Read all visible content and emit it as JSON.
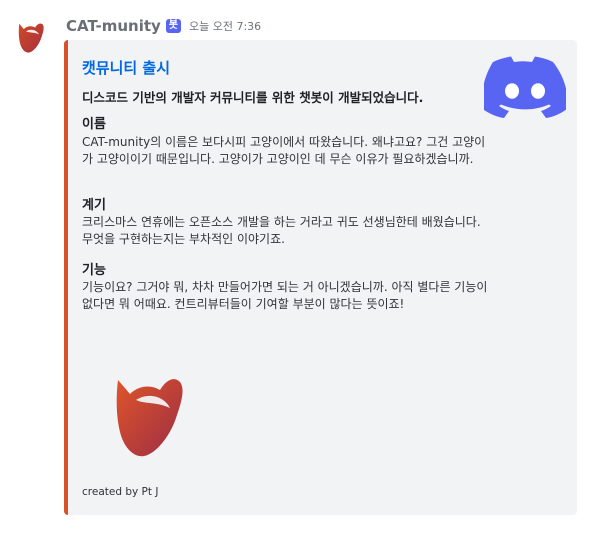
{
  "message": {
    "avatar_icon": "cat-logo-icon",
    "username": "CAT-munity",
    "bot_tag": "봇",
    "timestamp": "오늘 오전 7:36"
  },
  "embed": {
    "accent_color": "#d7522a",
    "thumbnail_icon": "discord-logo-icon",
    "title": "캣뮤니티 출시",
    "description": "디스코드 기반의 개발자 커뮤니티를 위한 챗봇이 개발되었습니다.",
    "fields": [
      {
        "name": "이름",
        "value": "CAT-munity의 이름은 보다시피 고양이에서 따왔습니다. 왜냐고요? 그건 고양이가 고양이이기 때문입니다. 고양이가 고양이인 데 무슨 이유가 필요하겠습니까."
      },
      {
        "name": "계기",
        "value": "크리스마스 연휴에는 오픈소스 개발을 하는 거라고 귀도 선생님한테 배웠습니다. 무엇을 구현하는지는 부차적인 이야기죠."
      },
      {
        "name": "기능",
        "value": "기능이요? 그거야 뭐, 차차 만들어가면 되는 거 아니겠습니까. 아직 별다른 기능이 없다면 뭐 어때요. 컨트리뷰터들이 기여할 부분이 많다는 뜻이죠!"
      }
    ],
    "image_icon": "cat-logo-icon",
    "footer": "created by Pt J"
  },
  "colors": {
    "link_title": "#0068e0",
    "bot_tag_bg": "#5865f2",
    "embed_bg": "#f2f3f5"
  }
}
